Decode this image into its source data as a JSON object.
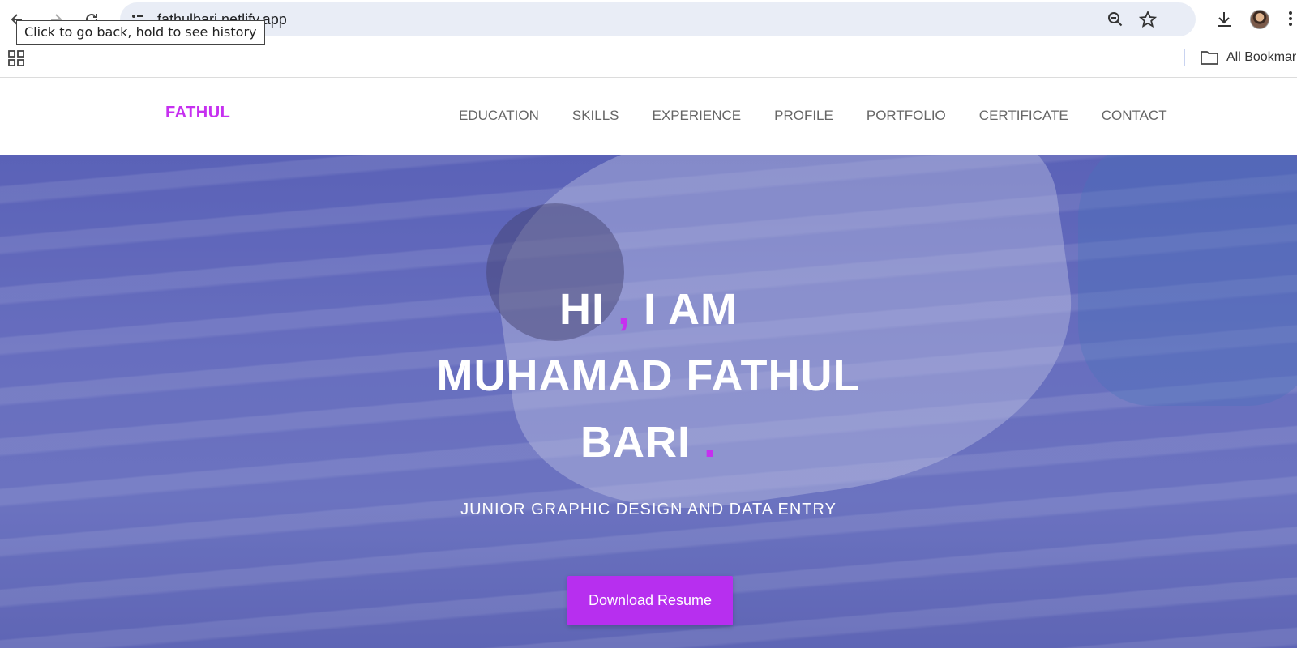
{
  "browser": {
    "url": "fathulbari.netlify.app",
    "tooltip": "Click to go back, hold to see history",
    "bookmarks_label": "All Bookmarks"
  },
  "site": {
    "logo": "FATHUL",
    "nav": [
      "EDUCATION",
      "SKILLS",
      "EXPERIENCE",
      "PROFILE",
      "PORTFOLIO",
      "CERTIFICATE",
      "CONTACT"
    ]
  },
  "hero": {
    "line1_a": "HI ",
    "line1_comma": ",",
    "line1_b": " I AM",
    "line2": "MUHAMAD FATHUL",
    "line3": "BARI ",
    "line3_dot": ".",
    "subtitle": "JUNIOR GRAPHIC DESIGN AND DATA ENTRY",
    "cta": "Download Resume"
  },
  "colors": {
    "accent": "#c630f0",
    "button": "#b72fef",
    "hero_tint": "#6b72c2"
  }
}
